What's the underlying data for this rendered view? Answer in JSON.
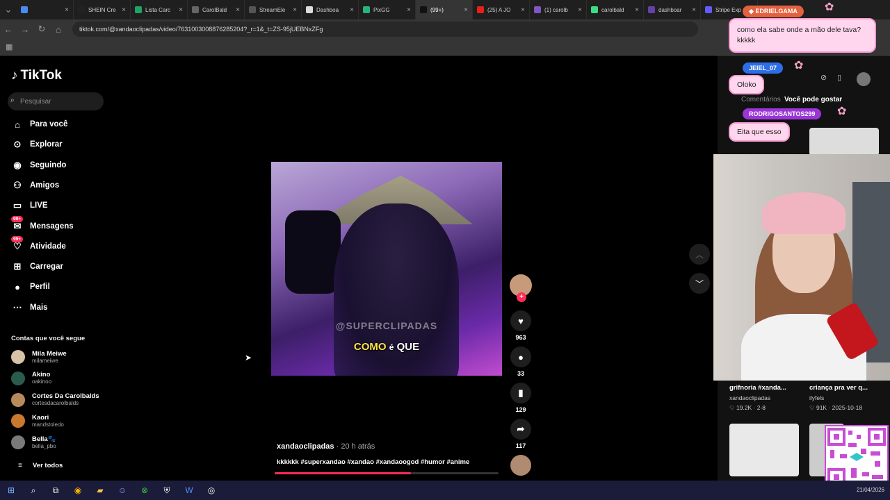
{
  "tabs": [
    {
      "label": "",
      "color": "#4a8af4"
    },
    {
      "label": "SHEIN Cre",
      "color": "#222"
    },
    {
      "label": "Lista Carc",
      "color": "#1fa463"
    },
    {
      "label": "CarolBald",
      "color": "#666"
    },
    {
      "label": "StreamEle",
      "color": "#555"
    },
    {
      "label": "Dashboa",
      "color": "#ddd"
    },
    {
      "label": "PixGG",
      "color": "#2ab27b"
    },
    {
      "label": "(99+) ",
      "color": "#111",
      "active": true
    },
    {
      "label": "(25) A JO",
      "color": "#e62117"
    },
    {
      "label": "(1) carolb",
      "color": "#7e57c2"
    },
    {
      "label": "carolbald",
      "color": "#3ddc84"
    },
    {
      "label": "dashboar",
      "color": "#6441a5"
    },
    {
      "label": "Stripe Exp",
      "color": "#635bff"
    }
  ],
  "address": {
    "url": "tiktok.com/@xandaoclipadas/video/7631003008876285204?_r=1&_t=ZS-95jUEBNxZFg"
  },
  "sidebar": {
    "logo": "TikTok",
    "search_placeholder": "Pesquisar",
    "nav": [
      {
        "label": "Para você",
        "icon": "home-icon"
      },
      {
        "label": "Explorar",
        "icon": "compass-icon"
      },
      {
        "label": "Seguindo",
        "icon": "avatar-icon"
      },
      {
        "label": "Amigos",
        "icon": "friends-icon"
      },
      {
        "label": "LIVE",
        "icon": "live-icon"
      },
      {
        "label": "Mensagens",
        "icon": "messages-icon",
        "badge": "99+"
      },
      {
        "label": "Atividade",
        "icon": "activity-icon",
        "badge": "99+"
      },
      {
        "label": "Carregar",
        "icon": "upload-icon"
      },
      {
        "label": "Perfil",
        "icon": "profile-icon"
      },
      {
        "label": "Mais",
        "icon": "more-icon"
      }
    ],
    "following_title": "Contas que você segue",
    "accounts": [
      {
        "name": "Mila Meiwe",
        "handle": "milameiwe",
        "color": "#d7c3a8"
      },
      {
        "name": "Akino",
        "handle": "oakinoo",
        "color": "#2a5b4c"
      },
      {
        "name": "Cortes Da Carolbalds",
        "handle": "cortesdacarolbalds",
        "color": "#b88a5b"
      },
      {
        "name": "Kaori",
        "handle": "mandstoledo",
        "color": "#c9782e"
      },
      {
        "name": "Bella🐾",
        "handle": "bella_pbo",
        "color": "#7a7a7a"
      }
    ],
    "see_all": "Ver todos"
  },
  "video": {
    "watermark": "@SUPERCLIPADAS",
    "caption_a": "COMO",
    "caption_b": "é",
    "caption_c": "QUE",
    "progress": 0.61
  },
  "actions": {
    "likes": "963",
    "comments": "33",
    "saves": "129",
    "shares": "117"
  },
  "post": {
    "user": "xandaoclipadas",
    "time": " · 20 h atrás",
    "description": "kkkkkk #superxandao #xandao #xandaoogod #humor #anime"
  },
  "right": {
    "tab_comments": "Comentários",
    "tab_like": "Você pode gostar",
    "cards": [
      {
        "title": "grifnoria #xanda...",
        "user": "xandaoclipadas",
        "meta": "♡ 19.2K · 2-8"
      },
      {
        "title": "criança pra ver q...",
        "user": "ilyfels",
        "meta": "♡ 91K · 2025-10-18"
      }
    ]
  },
  "overlay": {
    "chat1_user": "EDRIELGAMA",
    "chat1_text": "como ela sabe onde a mão dele tava? kkkkk",
    "chat2_user": "JEIEL_07",
    "chat2_text": "Oloko",
    "chat3_user": "RODRIGOSANTOS299",
    "chat3_text": "Eita que esso"
  },
  "taskbar": {
    "date": "21/04/2026"
  }
}
